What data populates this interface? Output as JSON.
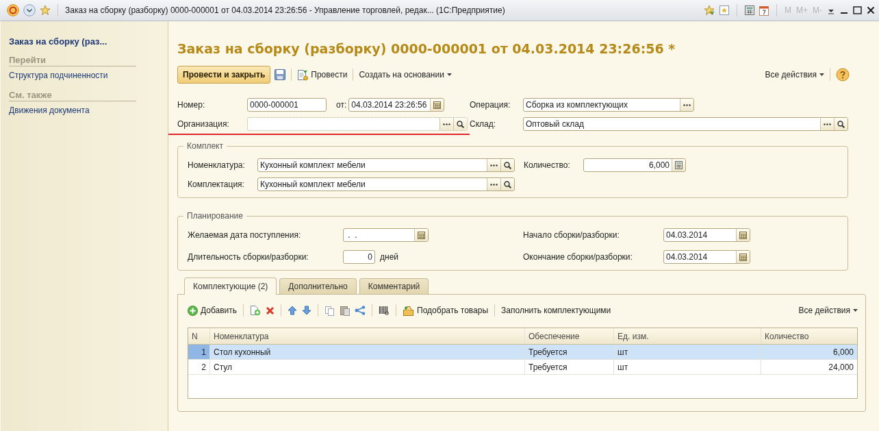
{
  "window": {
    "title": "Заказ на сборку (разборку) 0000-000001 от 04.03.2014 23:26:56 - Управление торговлей, редак... (1С:Предприятие)",
    "memory_buttons": [
      {
        "label": "M",
        "disabled": true
      },
      {
        "label": "M+",
        "disabled": true
      },
      {
        "label": "M-",
        "disabled": true
      }
    ]
  },
  "sidebar": {
    "title": "Заказ на сборку (раз...",
    "sections": [
      {
        "heading": "Перейти",
        "links": [
          "Структура подчиненности"
        ]
      },
      {
        "heading": "См. также",
        "links": [
          "Движения документа"
        ]
      }
    ]
  },
  "form": {
    "title": "Заказ на сборку (разборку) 0000-000001 от 04.03.2014 23:26:56 *",
    "toolbar": {
      "primary_button": "Провести и закрыть",
      "post_button": "Провести",
      "create_based_on": "Создать на основании",
      "all_actions": "Все действия"
    },
    "number": {
      "label": "Номер:",
      "value": "0000-000001"
    },
    "date": {
      "label": "от:",
      "value": "04.03.2014 23:26:56",
      "buttons": [
        {
          "kind": "calendar"
        }
      ]
    },
    "operation": {
      "label": "Операция:",
      "value": "Сборка из комплектующих",
      "buttons": [
        {
          "kind": "select"
        }
      ]
    },
    "organization": {
      "label": "Организация:",
      "invalid": true,
      "buttons": [
        {
          "kind": "select"
        },
        {
          "kind": "open"
        }
      ]
    },
    "warehouse": {
      "label": "Склад:",
      "value": "Оптовый склад",
      "buttons": [
        {
          "kind": "select"
        },
        {
          "kind": "open"
        }
      ]
    },
    "kit": {
      "title": "Комплект",
      "item": {
        "label": "Номенклатура:",
        "value": "Кухонный комплект мебели",
        "buttons": [
          {
            "kind": "select"
          },
          {
            "kind": "open"
          }
        ]
      },
      "quantity": {
        "label": "Количество:",
        "value": "6,000",
        "buttons": [
          {
            "kind": "calculator"
          }
        ]
      },
      "configuration": {
        "label": "Комплектация:",
        "value": "Кухонный комплект мебели",
        "buttons": [
          {
            "kind": "select"
          },
          {
            "kind": "open"
          }
        ]
      }
    },
    "planning": {
      "title": "Планирование",
      "desired_date": {
        "label": "Желаемая дата поступления:",
        "value": " .  .",
        "buttons": [
          {
            "kind": "calendar"
          }
        ]
      },
      "duration": {
        "label": "Длительность сборки/разборки:",
        "value": "0",
        "unit": "дней"
      },
      "start": {
        "label": "Начало сборки/разборки:",
        "value": "04.03.2014",
        "buttons": [
          {
            "kind": "calendar"
          }
        ]
      },
      "end": {
        "label": "Окончание сборки/разборки:",
        "value": "04.03.2014",
        "buttons": [
          {
            "kind": "calendar"
          }
        ]
      }
    },
    "tabs": [
      {
        "label": "Комплектующие (2)",
        "selected": true
      },
      {
        "label": "Дополнительно",
        "selected": false
      },
      {
        "label": "Комментарий",
        "selected": false
      }
    ],
    "table_toolbar": {
      "add": "Добавить",
      "pick": "Подобрать товары",
      "fill": "Заполнить комплектующими",
      "all_actions": "Все действия"
    },
    "table": {
      "columns": [
        "N",
        "Номенклатура",
        "Обеспечение",
        "Ед. изм.",
        "Количество"
      ],
      "rows": [
        {
          "selected": true,
          "cells": [
            "1",
            "Стол кухонный",
            "Требуется",
            "шт",
            "6,000"
          ]
        },
        {
          "selected": false,
          "cells": [
            "2",
            "Стул",
            "Требуется",
            "шт",
            "24,000"
          ]
        }
      ]
    }
  }
}
